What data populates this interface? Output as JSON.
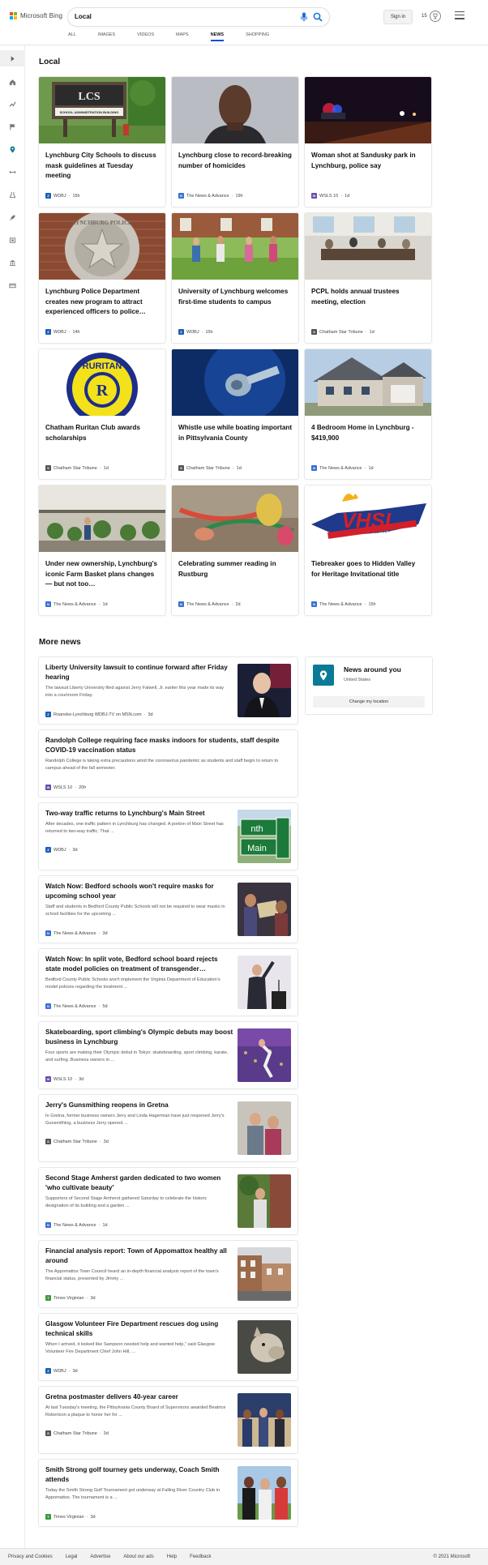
{
  "header": {
    "brand": "Microsoft Bing",
    "search_value": "Local",
    "signin_label": "Sign in",
    "rewards_count": "15",
    "tabs": [
      {
        "label": "All"
      },
      {
        "label": "Images"
      },
      {
        "label": "Videos"
      },
      {
        "label": "Maps"
      },
      {
        "label": "News",
        "active": true
      },
      {
        "label": "Shopping"
      }
    ]
  },
  "sidebar": {
    "icons": [
      "expand-icon",
      "home-icon",
      "trending-icon",
      "flag-icon",
      "location-pin-icon",
      "fitness-icon",
      "science-icon",
      "rocket-icon",
      "entertainment-icon",
      "politics-icon",
      "money-icon"
    ]
  },
  "local": {
    "title": "Local",
    "cards": [
      {
        "title": "Lynchburg City Schools to discuss mask guidelines at Tuesday meeting",
        "source": "WDBJ",
        "time": "15h"
      },
      {
        "title": "Lynchburg close to record-breaking number of homicides",
        "source": "The News & Advance",
        "time": "19h"
      },
      {
        "title": "Woman shot at Sandusky park in Lynchburg, police say",
        "source": "WSLS 10",
        "time": "1d"
      },
      {
        "title": "Lynchburg Police Department creates new program to attract experienced officers to police…",
        "source": "WDBJ",
        "time": "14h"
      },
      {
        "title": "University of Lynchburg welcomes first-time students to campus",
        "source": "WDBJ",
        "time": "15h"
      },
      {
        "title": "PCPL holds annual trustees meeting, election",
        "source": "Chatham Star Tribune",
        "time": "1d"
      },
      {
        "title": "Chatham Ruritan Club awards scholarships",
        "source": "Chatham Star Tribune",
        "time": "1d"
      },
      {
        "title": "Whistle use while boating important in Pittsylvania County",
        "source": "Chatham Star Tribune",
        "time": "1d"
      },
      {
        "title": "4 Bedroom Home in Lynchburg - $419,900",
        "source": "The News & Advance",
        "time": "1d"
      },
      {
        "title": "Under new ownership, Lynchburg's iconic Farm Basket plans changes — but not too…",
        "source": "The News & Advance",
        "time": "1d"
      },
      {
        "title": "Celebrating summer reading in Rustburg",
        "source": "The News & Advance",
        "time": "2d"
      },
      {
        "title": "Tiebreaker goes to Hidden Valley for Heritage Invitational title",
        "source": "The News & Advance",
        "time": "15h"
      }
    ],
    "image_text": {
      "lcs_sign": "LCS",
      "lcs_sign_small": "SCHOOL ADMINISTRATION BUILDING",
      "police_badge": "LYNCHBURG POLICE",
      "ruritan": "RURITAN",
      "vhsl": "VHSL",
      "vhsl_banner": "SERVING YOUTH SINCE 1913",
      "street_sign_1": "nth",
      "street_sign_2": "Main"
    }
  },
  "more_news": {
    "title": "More news",
    "items": [
      {
        "title": "Liberty University lawsuit to continue forward after Friday hearing",
        "snippet": "The lawsuit Liberty University filed against Jerry Falwell, Jr. earlier this year made its way into a courtroom Friday.",
        "source": "Roanoke-Lynchburg WDBJ-TV on MSN.com",
        "time": "3d"
      },
      {
        "title": "Randolph College requiring face masks indoors for students, staff despite COVID-19 vaccination status",
        "snippet": "Randolph College is taking extra precautions amid the coronavirus pandemic as students and staff begin to return to campus ahead of the fall semester.",
        "source": "WSLS 10",
        "time": "20h"
      },
      {
        "title": "Two-way traffic returns to Lynchburg's Main Street",
        "snippet": "After decades, one traffic pattern in Lynchburg has changed. A portion of Main Street has returned to two-way traffic. That ...",
        "source": "WDBJ",
        "time": "3d"
      },
      {
        "title": "Watch Now: Bedford schools won't require masks for upcoming school year",
        "snippet": "Staff and students in Bedford County Public Schools will not be required to wear masks in school facilities for the upcoming ...",
        "source": "The News & Advance",
        "time": "3d"
      },
      {
        "title": "Watch Now: In split vote, Bedford school board rejects state model policies on treatment of transgender…",
        "snippet": "Bedford County Public Schools won't implement the Virginia Department of Education's model policies regarding the treatment ...",
        "source": "The News & Advance",
        "time": "5d"
      },
      {
        "title": "Skateboarding, sport climbing's Olympic debuts may boost business in Lynchburg",
        "snippet": "Four sports are making their Olympic debut in Tokyo: skateboarding, sport climbing, karate, and surfing. Business owners in ...",
        "source": "WSLS 10",
        "time": "3d"
      },
      {
        "title": "Jerry's Gunsmithing reopens in Gretna",
        "snippet": "In Gretna, former business owners Jerry and Linda Hagerman have just reopened Jerry's Gunsmithing, a business Jerry opened ...",
        "source": "Chatham Star Tribune",
        "time": "3d"
      },
      {
        "title": "Second Stage Amherst garden dedicated to two women 'who cultivate beauty'",
        "snippet": "Supporters of Second Stage Amherst gathered Saturday to celebrate the historic designation of its building and a garden ...",
        "source": "The News & Advance",
        "time": "1d"
      },
      {
        "title": "Financial analysis report: Town of Appomattox healthy all around",
        "snippet": "The Appomattox Town Council heard an in-depth financial analysis report of the town's financial status, presented by Jimmy ...",
        "source": "Times Virginian",
        "time": "3d"
      },
      {
        "title": "Glasgow Volunteer Fire Department rescues dog using technical skills",
        "snippet": "When I arrived, it looked like Sampson needed help and wanted help,\" said Glasgow Volunteer Fire Department Chief John Hill, ...",
        "source": "WDBJ",
        "time": "3d"
      },
      {
        "title": "Gretna postmaster delivers 40-year career",
        "snippet": "At last Tuesday's meeting, the Pittsylvania County Board of Supervisors awarded Beatrice Robertson a plaque to honor her for ...",
        "source": "Chatham Star Tribune",
        "time": "3d"
      },
      {
        "title": "Smith Strong golf tourney gets underway, Coach Smith attends",
        "snippet": "Today the Smith Strong Golf Tournament got underway at Falling River Country Club in Appomattox. The tournament is a ...",
        "source": "Times Virginian",
        "time": "3d"
      }
    ]
  },
  "widget": {
    "title": "News around you",
    "location": "United States",
    "button_label": "Change my location"
  },
  "footer": {
    "links": [
      "Privacy and Cookies",
      "Legal",
      "Advertise",
      "About our ads",
      "Help",
      "Feedback"
    ],
    "copyright": "© 2021 Microsoft"
  },
  "colors": {
    "accent": "#174ae4",
    "pin_teal": "#0a7a96",
    "wdbj_blue": "#1d5fb8",
    "nna_blue": "#3b6fd6",
    "wsls_purple": "#6b4ca8",
    "tv_green": "#3c9a3c"
  }
}
